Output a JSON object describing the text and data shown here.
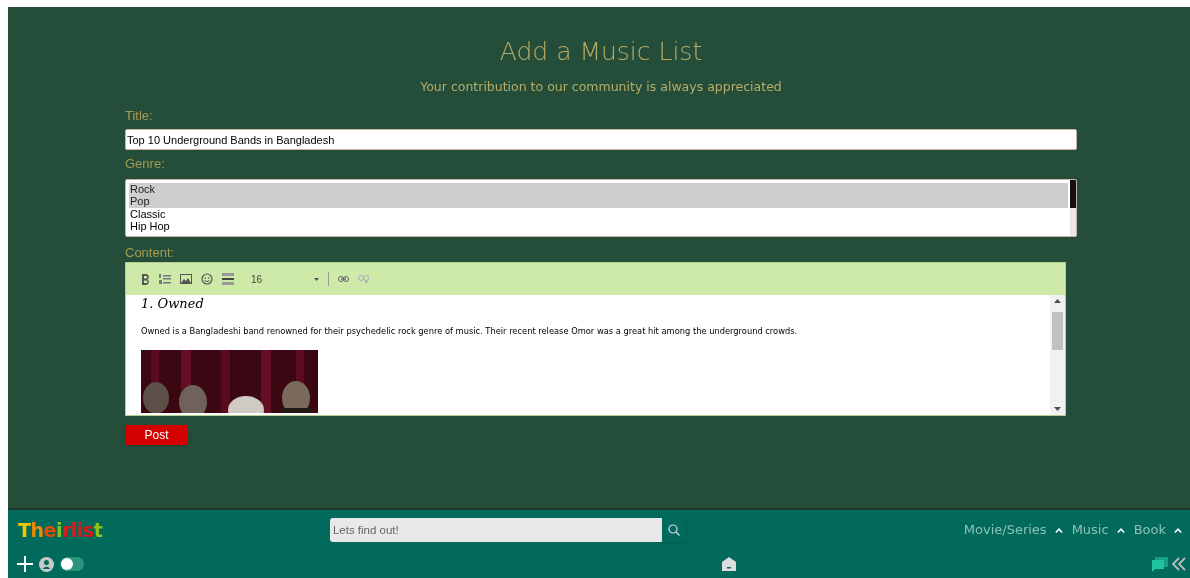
{
  "header": {
    "title": "Add a Music List",
    "subtitle": "Your contribution to our community is always appreciated"
  },
  "form": {
    "title_label": "Title:",
    "title_value": "Top 10 Underground Bands in Bangladesh",
    "genre_label": "Genre:",
    "genres": [
      {
        "label": "Rock",
        "selected": true
      },
      {
        "label": "Pop",
        "selected": true
      },
      {
        "label": "Classic",
        "selected": false
      },
      {
        "label": "Hip Hop",
        "selected": false
      }
    ],
    "content_label": "Content:",
    "toolbar": {
      "font_size": "16"
    },
    "editor": {
      "heading": "1. Owned",
      "paragraph": "Owned is a Bangladeshi band renowned for their psychedelic rock genre of music. Their recent release Omor was a great hit among the underground crowds."
    },
    "submit": "Post"
  },
  "footer": {
    "logo": "Theirlist",
    "search": {
      "placeholder": "Lets find out!"
    },
    "nav": [
      {
        "label": "Movie/Series"
      },
      {
        "label": "Music"
      },
      {
        "label": "Book"
      }
    ],
    "theme_toggle": {
      "on": false
    }
  }
}
